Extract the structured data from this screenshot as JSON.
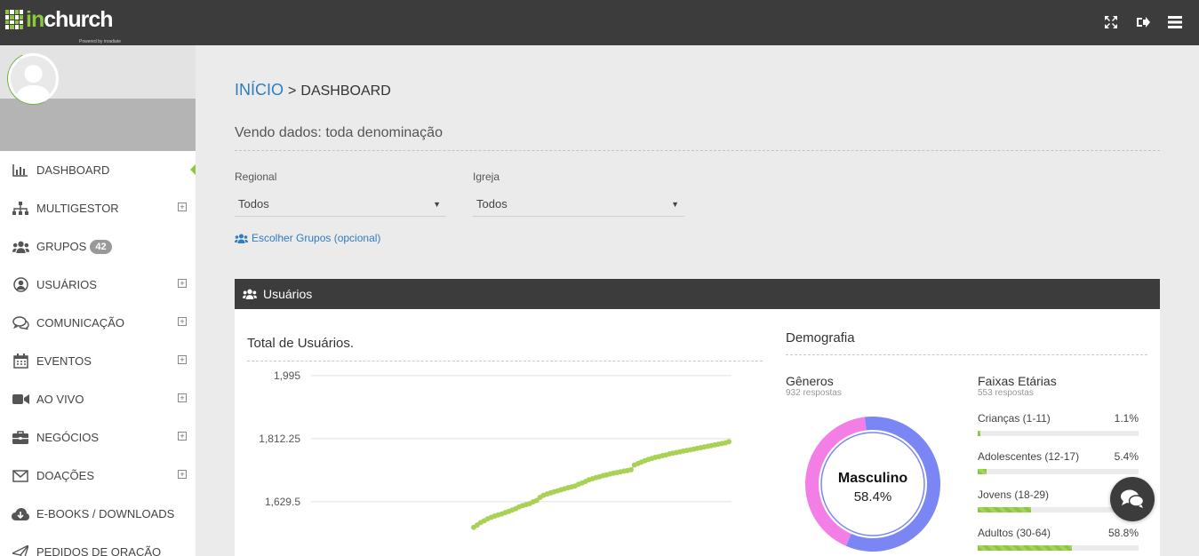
{
  "topbar": {
    "logo_in": "in",
    "logo_rest": "church",
    "logo_sub": "Powered by inradiate",
    "icons": [
      "fullscreen-icon",
      "logout-icon",
      "menu-icon"
    ]
  },
  "sidebar": {
    "items": [
      {
        "label": "DASHBOARD",
        "icon": "bar-chart-icon",
        "expandable": false
      },
      {
        "label": "MULTIGESTOR",
        "icon": "sitemap-icon",
        "expandable": true
      },
      {
        "label": "GRUPOS",
        "icon": "users-icon",
        "expandable": false,
        "badge": "42"
      },
      {
        "label": "USUÁRIOS",
        "icon": "user-circle-icon",
        "expandable": true
      },
      {
        "label": "COMUNICAÇÃO",
        "icon": "comments-icon",
        "expandable": true
      },
      {
        "label": "EVENTOS",
        "icon": "calendar-icon",
        "expandable": true
      },
      {
        "label": "AO VIVO",
        "icon": "video-icon",
        "expandable": true
      },
      {
        "label": "NEGÓCIOS",
        "icon": "briefcase-icon",
        "expandable": true
      },
      {
        "label": "DOAÇÕES",
        "icon": "envelope-icon",
        "expandable": true
      },
      {
        "label": "E-BOOKS / DOWNLOADS",
        "icon": "cloud-download-icon",
        "expandable": false
      },
      {
        "label": "PEDIDOS DE ORAÇÃO",
        "icon": "paper-plane-icon",
        "expandable": false
      }
    ],
    "active": 0,
    "plus_symbol": "+"
  },
  "main": {
    "breadcrumb": {
      "home": "INÍCIO",
      "sep": ">",
      "current": "DASHBOARD"
    },
    "viewing": "Vendo dados: toda denominação",
    "filters": {
      "regional_label": "Regional",
      "regional_value": "Todos",
      "igreja_label": "Igreja",
      "igreja_value": "Todos",
      "caret": "▼"
    },
    "groups_link": "Escolher Grupos (opcional)"
  },
  "panel": {
    "title": "Usuários",
    "total_title": "Total de Usuários.",
    "demografia_title": "Demografia",
    "generos": {
      "title": "Gêneros",
      "responses": "932 respostas",
      "label": "Masculino",
      "percent": "58.4%",
      "male_fraction": 0.584
    },
    "faixas": {
      "title": "Faixas Etárias",
      "responses": "553 respostas",
      "rows": [
        {
          "label": "Crianças (1-11)",
          "percent": "1.1%",
          "value": 1.1
        },
        {
          "label": "Adolescentes (12-17)",
          "percent": "5.4%",
          "value": 5.4
        },
        {
          "label": "Jovens (18-29)",
          "percent": "",
          "value": 33.0
        },
        {
          "label": "Adultos (30-64)",
          "percent": "58.8%",
          "value": 58.8
        }
      ]
    }
  },
  "colors": {
    "accent": "#8dc63f",
    "link": "#2f7cbf",
    "dark": "#3c3c3c",
    "male": "#7b86f5",
    "female": "#f27ee6"
  },
  "chart_data": {
    "type": "line",
    "title": "Total de Usuários.",
    "y_ticks": [
      "1,995",
      "1,812.25",
      "1,629.5"
    ],
    "ylim": [
      1560,
      2010
    ],
    "values": [
      1555,
      1562,
      1569,
      1574,
      1580,
      1584,
      1588,
      1591,
      1594,
      1598,
      1601,
      1605,
      1609,
      1614,
      1618,
      1621,
      1624,
      1629,
      1633,
      1642,
      1648,
      1652,
      1655,
      1658,
      1661,
      1664,
      1667,
      1670,
      1672,
      1675,
      1680,
      1684,
      1688,
      1693,
      1696,
      1699,
      1702,
      1705,
      1707,
      1710,
      1712,
      1714,
      1716,
      1718,
      1720,
      1722,
      1736,
      1740,
      1744,
      1748,
      1752,
      1755,
      1758,
      1760,
      1763,
      1765,
      1768,
      1770,
      1772,
      1774,
      1776,
      1778,
      1780,
      1782,
      1784,
      1786,
      1788,
      1790,
      1792,
      1794,
      1796,
      1798,
      1800,
      1803
    ]
  }
}
